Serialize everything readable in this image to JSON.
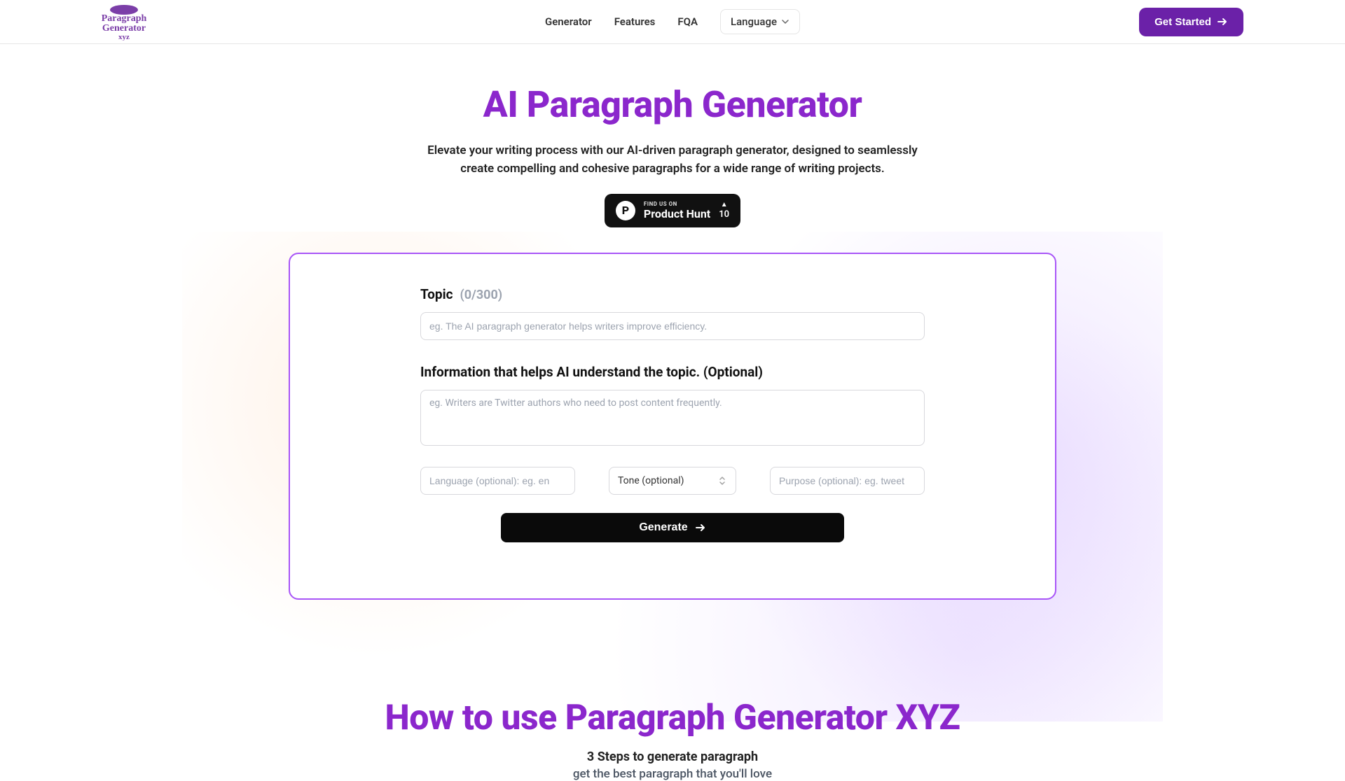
{
  "nav": {
    "generator": "Generator",
    "features": "Features",
    "faq": "FQA",
    "language": "Language",
    "get_started": "Get Started"
  },
  "hero": {
    "title": "AI Paragraph Generator",
    "subtitle": "Elevate your writing process with our AI-driven paragraph generator, designed to seamlessly create compelling and cohesive paragraphs for a wide range of writing projects."
  },
  "product_hunt": {
    "find_us": "FIND US ON",
    "name": "Product Hunt",
    "votes": "10"
  },
  "form": {
    "topic_label": "Topic",
    "topic_counter": "(0/300)",
    "topic_placeholder": "eg. The AI paragraph generator helps writers improve efficiency.",
    "info_label": "Information that helps AI understand the topic. (Optional)",
    "info_placeholder": "eg. Writers are Twitter authors who need to post content frequently.",
    "language_placeholder": "Language (optional): eg. en",
    "tone_label": "Tone (optional)",
    "purpose_placeholder": "Purpose (optional): eg. tweet",
    "generate": "Generate"
  },
  "howto": {
    "title": "How to use Paragraph Generator XYZ",
    "sub1": "3 Steps to generate paragraph",
    "sub2": "get the best paragraph that you'll love"
  }
}
